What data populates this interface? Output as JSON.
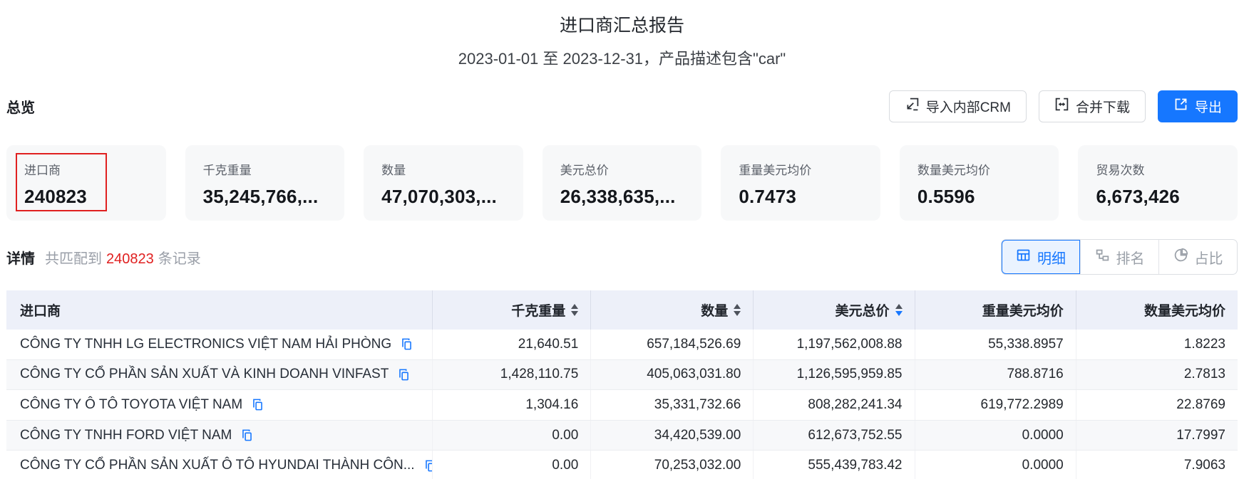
{
  "report": {
    "title": "进口商汇总报告",
    "subtitle": "2023-01-01 至 2023-12-31，产品描述包含\"car\""
  },
  "overview": {
    "heading": "总览",
    "buttons": {
      "import_crm": "导入内部CRM",
      "merge_download": "合并下载",
      "export": "导出"
    },
    "cards": [
      {
        "label": "进口商",
        "value": "240823",
        "highlighted": true
      },
      {
        "label": "千克重量",
        "value": "35,245,766,..."
      },
      {
        "label": "数量",
        "value": "47,070,303,..."
      },
      {
        "label": "美元总价",
        "value": "26,338,635,..."
      },
      {
        "label": "重量美元均价",
        "value": "0.7473"
      },
      {
        "label": "数量美元均价",
        "value": "0.5596"
      },
      {
        "label": "贸易次数",
        "value": "6,673,426"
      }
    ]
  },
  "detail": {
    "heading": "详情",
    "match_prefix": "共匹配到",
    "match_count": "240823",
    "match_suffix": "条记录",
    "tabs": [
      {
        "label": "明细",
        "icon": "table-icon",
        "active": true
      },
      {
        "label": "排名",
        "icon": "rank-icon",
        "active": false
      },
      {
        "label": "占比",
        "icon": "pie-icon",
        "active": false
      }
    ]
  },
  "table": {
    "columns": [
      {
        "label": "进口商",
        "align": "left",
        "sortable": false
      },
      {
        "label": "千克重量",
        "align": "right",
        "sortable": true,
        "sort": "none"
      },
      {
        "label": "数量",
        "align": "right",
        "sortable": true,
        "sort": "none"
      },
      {
        "label": "美元总价",
        "align": "right",
        "sortable": true,
        "sort": "desc"
      },
      {
        "label": "重量美元均价",
        "align": "right",
        "sortable": false
      },
      {
        "label": "数量美元均价",
        "align": "right",
        "sortable": false
      }
    ],
    "rows": [
      {
        "name": "CÔNG TY TNHH LG ELECTRONICS VIỆT NAM HẢI PHÒNG",
        "kg": "21,640.51",
        "qty": "657,184,526.69",
        "usd": "1,197,562,008.88",
        "kg_avg": "55,338.8957",
        "qty_avg": "1.8223"
      },
      {
        "name": "CÔNG TY CỔ PHẦN SẢN XUẤT VÀ KINH DOANH VINFAST",
        "kg": "1,428,110.75",
        "qty": "405,063,031.80",
        "usd": "1,126,595,959.85",
        "kg_avg": "788.8716",
        "qty_avg": "2.7813"
      },
      {
        "name": "CÔNG TY Ô TÔ TOYOTA VIỆT NAM",
        "kg": "1,304.16",
        "qty": "35,331,732.66",
        "usd": "808,282,241.34",
        "kg_avg": "619,772.2989",
        "qty_avg": "22.8769"
      },
      {
        "name": "CÔNG TY TNHH FORD VIỆT NAM",
        "kg": "0.00",
        "qty": "34,420,539.00",
        "usd": "612,673,752.55",
        "kg_avg": "0.0000",
        "qty_avg": "17.7997"
      },
      {
        "name": "CÔNG TY CỔ PHẦN SẢN XUẤT Ô TÔ HYUNDAI THÀNH CÔN...",
        "kg": "0.00",
        "qty": "70,253,032.00",
        "usd": "555,439,783.42",
        "kg_avg": "0.0000",
        "qty_avg": "7.9063"
      }
    ]
  },
  "colors": {
    "accent_blue": "#1677ff",
    "alert_red": "#e02020",
    "table_header_bg": "#edf0f9",
    "card_bg": "#f7f8f9"
  }
}
